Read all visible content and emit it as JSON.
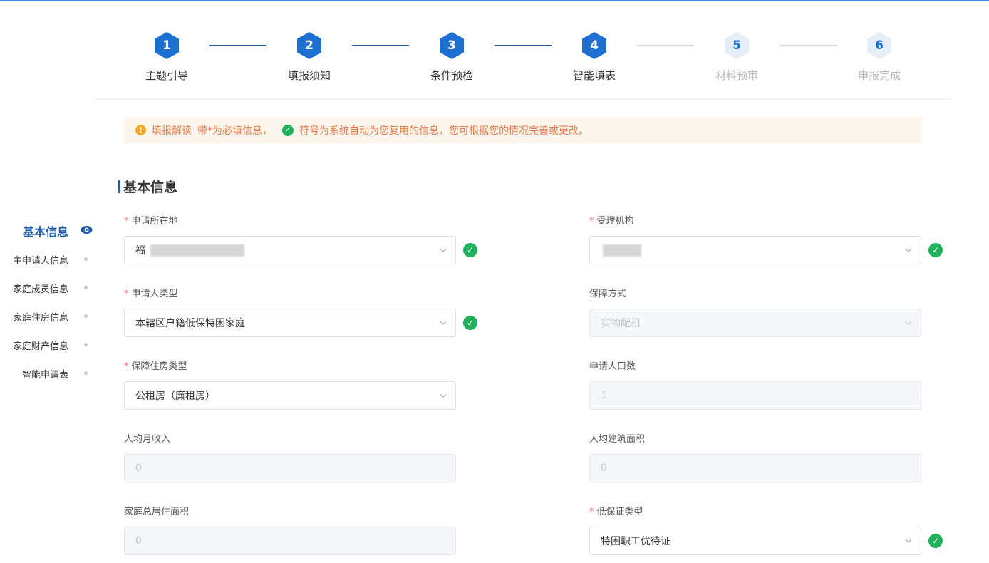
{
  "steps": [
    {
      "num": "1",
      "label": "主题引导",
      "state": "active"
    },
    {
      "num": "2",
      "label": "填报须知",
      "state": "active"
    },
    {
      "num": "3",
      "label": "条件预检",
      "state": "active"
    },
    {
      "num": "4",
      "label": "智能填表",
      "state": "active"
    },
    {
      "num": "5",
      "label": "材料预审",
      "state": "inactive"
    },
    {
      "num": "6",
      "label": "申报完成",
      "state": "inactive"
    }
  ],
  "notice": {
    "title": "填报解读",
    "text1": "带*为必填信息，",
    "text2": "符号为系统自动为您复用的信息，您可根据您的情况完善或更改。"
  },
  "section_title": "基本信息",
  "side_nav": {
    "items": [
      "基本信息",
      "主申请人信息",
      "家庭成员信息",
      "家庭住房信息",
      "家庭财产信息",
      "智能申请表"
    ]
  },
  "form": {
    "apply_location": {
      "label": "申请所在地",
      "value": "福"
    },
    "acceptance_agency": {
      "label": "受理机构",
      "value": ""
    },
    "applicant_type": {
      "label": "申请人类型",
      "value": "本辖区户籍低保特困家庭"
    },
    "guarantee_method": {
      "label": "保障方式",
      "value": "实物配租"
    },
    "housing_type": {
      "label": "保障住房类型",
      "value": "公租房（廉租房）"
    },
    "population": {
      "label": "申请人口数",
      "value": "1"
    },
    "monthly_income": {
      "label": "人均月收入",
      "value": "0"
    },
    "building_area": {
      "label": "人均建筑面积",
      "value": "0"
    },
    "total_area": {
      "label": "家庭总居住面积",
      "value": "0"
    },
    "low_guarantee_type": {
      "label": "低保证类型",
      "value": "特困职工优待证"
    }
  },
  "colors": {
    "accent": "#1d6fd0",
    "success": "#1fb15c",
    "warning": "#e6794a"
  }
}
